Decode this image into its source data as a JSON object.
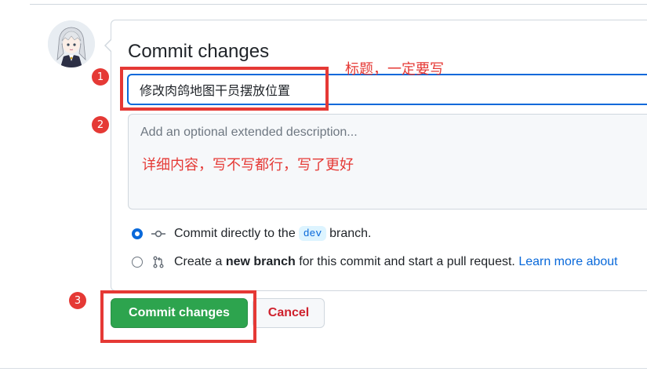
{
  "commit_form": {
    "title": "Commit changes",
    "summary_value": "修改肉鸽地图干员摆放位置",
    "description_placeholder": "Add an optional extended description...",
    "option_direct": {
      "prefix": "Commit directly to the",
      "branch": "dev",
      "suffix": "branch."
    },
    "option_new_branch": {
      "prefix": "Create a",
      "bold": "new branch",
      "middle": "for this commit and start a pull request.",
      "link": "Learn more about"
    },
    "commit_button": "Commit changes",
    "cancel_button": "Cancel"
  },
  "annotations": {
    "markers": [
      "1",
      "2",
      "3"
    ],
    "title_note": "标题，一定要写",
    "description_note": "详细内容，写不写都行，写了更好"
  },
  "colors": {
    "accent": "#0969da",
    "primary_button": "#2da44e",
    "danger_text": "#cf222e",
    "annotation_red": "#e53935",
    "branch_badge_bg": "#ddf4ff"
  },
  "icons": {
    "avatar": "anime-character-avatar",
    "commit": "git-commit-icon",
    "pull_request": "git-pull-request-icon"
  }
}
